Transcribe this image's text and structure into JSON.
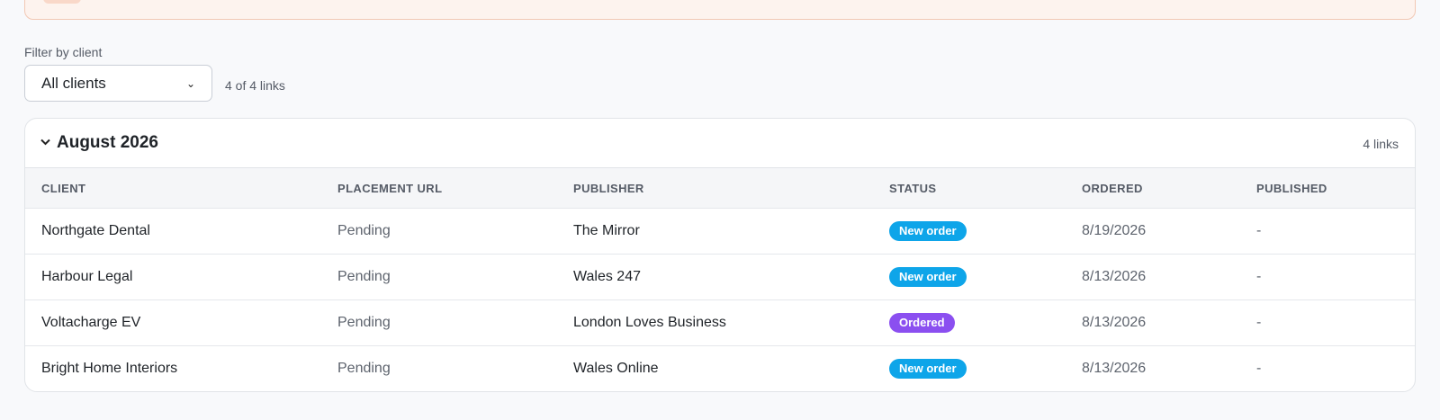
{
  "filter": {
    "label": "Filter by client",
    "selected": "All clients",
    "count_text": "4 of 4 links"
  },
  "group": {
    "title": "August 2026",
    "count_text": "4 links"
  },
  "columns": [
    "CLIENT",
    "PLACEMENT URL",
    "PUBLISHER",
    "STATUS",
    "ORDERED",
    "PUBLISHED"
  ],
  "rows": [
    {
      "client": "Northgate Dental",
      "placement_url": "Pending",
      "publisher": "The Mirror",
      "status": "New order",
      "ordered": "8/19/2026",
      "published": "-"
    },
    {
      "client": "Harbour Legal",
      "placement_url": "Pending",
      "publisher": "Wales 247",
      "status": "New order",
      "ordered": "8/13/2026",
      "published": "-"
    },
    {
      "client": "Voltacharge EV",
      "placement_url": "Pending",
      "publisher": "London Loves Business",
      "status": "Ordered",
      "ordered": "8/13/2026",
      "published": "-"
    },
    {
      "client": "Bright Home Interiors",
      "placement_url": "Pending",
      "publisher": "Wales Online",
      "status": "New order",
      "ordered": "8/13/2026",
      "published": "-"
    }
  ],
  "status_colors": {
    "New order": "#0ea5e9",
    "Ordered": "#8b4ff0"
  }
}
